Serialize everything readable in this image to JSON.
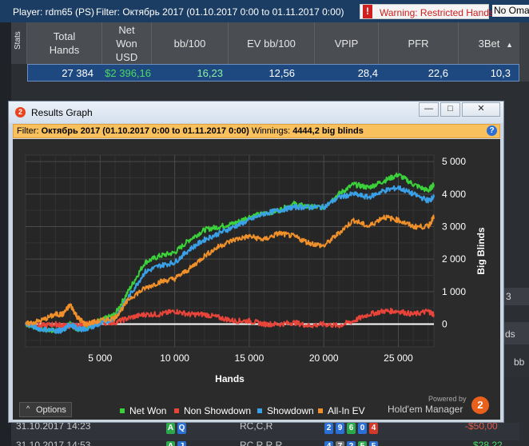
{
  "topbar": {
    "player": "Player: rdm65 (PS)",
    "filter": "Filter: Октябрь 2017 (01.10.2017 0:00 to 01.11.2017 0:00)",
    "warning_mark": "!",
    "warning": "Warning: Restricted Hands",
    "no_omaha": "No Omah"
  },
  "stats": {
    "tab_label": "Stats",
    "columns": [
      {
        "label_lines": [
          "Total",
          "Hands"
        ]
      },
      {
        "label_lines": [
          "Net",
          "Won",
          "USD"
        ]
      },
      {
        "label_lines": [
          "bb/100"
        ]
      },
      {
        "label_lines": [
          "EV bb/100"
        ]
      },
      {
        "label_lines": [
          "VPIP"
        ]
      },
      {
        "label_lines": [
          "PFR"
        ]
      },
      {
        "label_lines": [
          "3Bet"
        ]
      }
    ],
    "sort_indicator": "▲",
    "row": {
      "total_hands": "27 384",
      "net_won": "$2 396,16",
      "bb100": "16,23",
      "ev_bb100": "12,56",
      "vpip": "28,4",
      "pfr": "22,6",
      "threebet": "10,3"
    },
    "colors": {
      "net_won": "#4cd964",
      "bb100": "#8ff0a4"
    }
  },
  "background": {
    "right_3": "3",
    "right_ds": "ds",
    "right_bb": "bb",
    "row1_date": "31.10.2017 14:23",
    "row1_action": "RC,C,R",
    "row1_amount": "-$50,00",
    "row2_date": "31.10.2017 14:53",
    "row2_action": "RC,R,R,R",
    "row2_amount": "$28,22"
  },
  "window": {
    "logo": "2",
    "title": "Results Graph",
    "min_btn": "—",
    "max_btn": "□",
    "close_btn": "✕",
    "filter_prefix": "Filter: ",
    "filter_bold": "Октябрь 2017 (01.10.2017 0:00 to 01.11.2017 0:00)",
    "winnings_prefix": " Winnings: ",
    "winnings_bold": "4444,2 big blinds",
    "help": "?",
    "options_label": "Options",
    "options_caret": "^",
    "powered_by": "Powered by",
    "brand": "Hold'em Manager",
    "brand_logo": "2"
  },
  "chart_data": {
    "type": "line",
    "xlabel": "Hands",
    "ylabel": "Big Blinds",
    "xlim": [
      0,
      27384
    ],
    "ylim": [
      -700,
      5200
    ],
    "x_ticks": [
      5000,
      10000,
      15000,
      20000,
      25000
    ],
    "x_tick_labels": [
      "5 000",
      "10 000",
      "15 000",
      "20 000",
      "25 000"
    ],
    "y_ticks": [
      0,
      1000,
      2000,
      3000,
      4000,
      5000
    ],
    "y_tick_labels": [
      "0",
      "1 000",
      "2 000",
      "3 000",
      "4 000",
      "5 000"
    ],
    "grid": true,
    "legend_position": "bottom",
    "x": [
      0,
      1000,
      2000,
      2500,
      3000,
      3500,
      4000,
      5000,
      6000,
      7000,
      8000,
      9000,
      10000,
      11000,
      12000,
      13000,
      14000,
      15000,
      16000,
      17000,
      18000,
      19000,
      20000,
      21000,
      22000,
      23000,
      24000,
      25000,
      26000,
      27000,
      27384
    ],
    "series": [
      {
        "name": "Net Won",
        "color": "#3ad13a",
        "values": [
          0,
          -150,
          -200,
          -150,
          0,
          -150,
          -100,
          100,
          300,
          1100,
          1900,
          2100,
          2200,
          2600,
          2900,
          3000,
          3100,
          3300,
          3400,
          3500,
          3700,
          3600,
          3600,
          4000,
          4300,
          4200,
          4400,
          4600,
          4300,
          4100,
          4300
        ]
      },
      {
        "name": "Non Showdown",
        "color": "#e8443a",
        "values": [
          0,
          -50,
          0,
          -50,
          -50,
          -50,
          0,
          50,
          50,
          200,
          300,
          300,
          400,
          300,
          300,
          200,
          100,
          100,
          0,
          0,
          50,
          -50,
          0,
          -50,
          100,
          300,
          400,
          400,
          300,
          400,
          300
        ]
      },
      {
        "name": "Showdown",
        "color": "#3aa0e8",
        "values": [
          0,
          -150,
          -200,
          -200,
          0,
          -150,
          -150,
          0,
          200,
          900,
          1600,
          1800,
          1900,
          2300,
          2600,
          2800,
          3000,
          3200,
          3400,
          3500,
          3600,
          3600,
          3600,
          3900,
          4000,
          3900,
          4100,
          4200,
          4000,
          3800,
          3900
        ]
      },
      {
        "name": "All-In EV",
        "color": "#f0902a",
        "values": [
          0,
          100,
          300,
          300,
          600,
          200,
          0,
          100,
          200,
          800,
          1100,
          1300,
          1400,
          1700,
          2100,
          2400,
          2600,
          2700,
          2600,
          2800,
          2700,
          2500,
          2400,
          2800,
          3200,
          3000,
          3300,
          3200,
          3000,
          3000,
          3300
        ]
      }
    ]
  }
}
